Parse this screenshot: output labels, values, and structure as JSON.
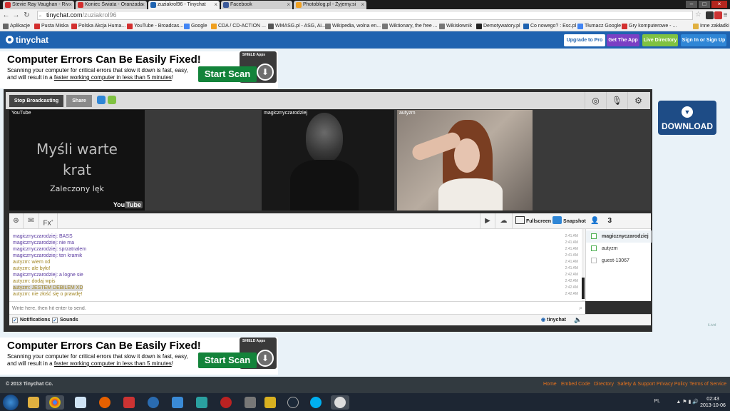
{
  "browser": {
    "tabs": [
      {
        "label": "Stevie Ray Vaughan - Riv",
        "color": "#d32f2f"
      },
      {
        "label": "Koniec Świata - Oranżada",
        "color": "#d32f2f"
      },
      {
        "label": "zuziakrol96 - Tinychat",
        "color": "#1f63b0"
      },
      {
        "label": "Facebook",
        "color": "#3b5998"
      },
      {
        "label": "Photoblog.pl - Żyjemy.si",
        "color": "#f0a020"
      }
    ],
    "url_host": "tinychat.com",
    "url_path": "/zuziakrol96",
    "bookmarks": [
      {
        "label": "Aplikacje",
        "color": "#666"
      },
      {
        "label": "Pusta Miska",
        "color": "#d32f2f"
      },
      {
        "label": "Polska Akcja Huma...",
        "color": "#d32f2f"
      },
      {
        "label": "YouTube - Broadcas...",
        "color": "#d32f2f"
      },
      {
        "label": "Google",
        "color": "#4285f4"
      },
      {
        "label": "CDA / CD-ACTION ...",
        "color": "#f0a020"
      },
      {
        "label": "WMASG.pl - ASG, Ai...",
        "color": "#555"
      },
      {
        "label": "Wikipedia, wolna en...",
        "color": "#777"
      },
      {
        "label": "Wiktionary, the free ...",
        "color": "#777"
      },
      {
        "label": "Wikisłownik",
        "color": "#777"
      },
      {
        "label": "Demotywatory.pl",
        "color": "#222"
      },
      {
        "label": "Co nowego? : Esc.pl",
        "color": "#1f63b0"
      },
      {
        "label": "Tłumacz Google",
        "color": "#4285f4"
      },
      {
        "label": "Gry komputerowe - ...",
        "color": "#d32f2f"
      },
      {
        "label": "Inne zakładki",
        "color": "#e0b040"
      }
    ]
  },
  "header": {
    "logo": "tinychat",
    "buttons": [
      {
        "label": "Upgrade to Pro",
        "bg": "#ffffff",
        "fg": "#1f63b0"
      },
      {
        "label": "Get The App",
        "bg": "#7b3fc4",
        "fg": "#ffffff"
      },
      {
        "label": "Live Directory",
        "bg": "#7fc241",
        "fg": "#ffffff"
      },
      {
        "label": "Sign In or Sign Up",
        "bg": "#2f86d6",
        "fg": "#ffffff"
      }
    ]
  },
  "ad": {
    "title": "Computer Errors Can Be Easily Fixed!",
    "desc_part1": "Scanning your computer for critical errors that slow it down is fast, easy, and will result in a ",
    "desc_link": "faster working computer in less than 5 minutes",
    "desc_end": "!",
    "box_label": "SHIELD Apps",
    "button": "Start Scan"
  },
  "room": {
    "stop_label": "Stop Broadcasting",
    "share_label": "Share",
    "cams": [
      {
        "name": "YouTube"
      },
      {
        "name": "magicznyczarodziej"
      },
      {
        "name": "autyzm"
      }
    ],
    "yt_line1": "Myśli warte",
    "yt_line2": "krat",
    "yt_line3": "Zaleczony lęk",
    "yt_logo_a": "You",
    "yt_logo_b": "Tube",
    "fullscreen": "Fullscreen",
    "snapshot": "Snapshot",
    "user_count": "3",
    "fx_label": "Fx"
  },
  "messages": [
    {
      "text": "magicznyczarodziej: BASS",
      "user": "u1",
      "time": "2:41 AM"
    },
    {
      "text": "magicznyczarodziej: nie ma",
      "user": "u1",
      "time": "2:41 AM"
    },
    {
      "text": "magicznyczarodziej: sprzatnalem",
      "user": "u1",
      "time": "2:41 AM"
    },
    {
      "text": "magicznyczarodziej: ten kramik",
      "user": "u1",
      "time": "2:41 AM"
    },
    {
      "text": "autyzm: wiem xd",
      "user": "u2",
      "time": "2:41 AM"
    },
    {
      "text": "autyzm: ale było!",
      "user": "u2",
      "time": "2:41 AM"
    },
    {
      "text": "magicznyczarodziej: a logne sie",
      "user": "u1",
      "time": "2:42 AM"
    },
    {
      "text": "autyzm: dodaj wpis",
      "user": "u2",
      "time": "2:42 AM"
    },
    {
      "text": "autyzm: JESTEM DEBILEM XD",
      "user": "u2",
      "time": "2:42 AM",
      "hl": true
    },
    {
      "text": "autyzm: nie złość się o prawdę!",
      "user": "u2",
      "time": "2:42 AM"
    }
  ],
  "users": [
    {
      "name": "magicznyczarodziej",
      "cam": true,
      "sel": true
    },
    {
      "name": "autyzm",
      "cam": true,
      "sel": false
    },
    {
      "name": "guest-13067",
      "cam": false,
      "sel": false
    }
  ],
  "chat": {
    "placeholder": "Write here, then hit enter to send.",
    "notifications": "Notifications",
    "sounds": "Sounds",
    "brand": "tinychat"
  },
  "download": {
    "label": "DOWNLOAD"
  },
  "footer": {
    "copyright": "© 2013 Tinychat Co.",
    "links": [
      "Home",
      "Embed Code",
      "Directory",
      "Safety & Support",
      "Privacy Policy",
      "Terms of Service"
    ]
  },
  "taskbar": {
    "locale": "PL",
    "time": "02:43",
    "date": "2013-10-06"
  },
  "watermark": "iLivid"
}
